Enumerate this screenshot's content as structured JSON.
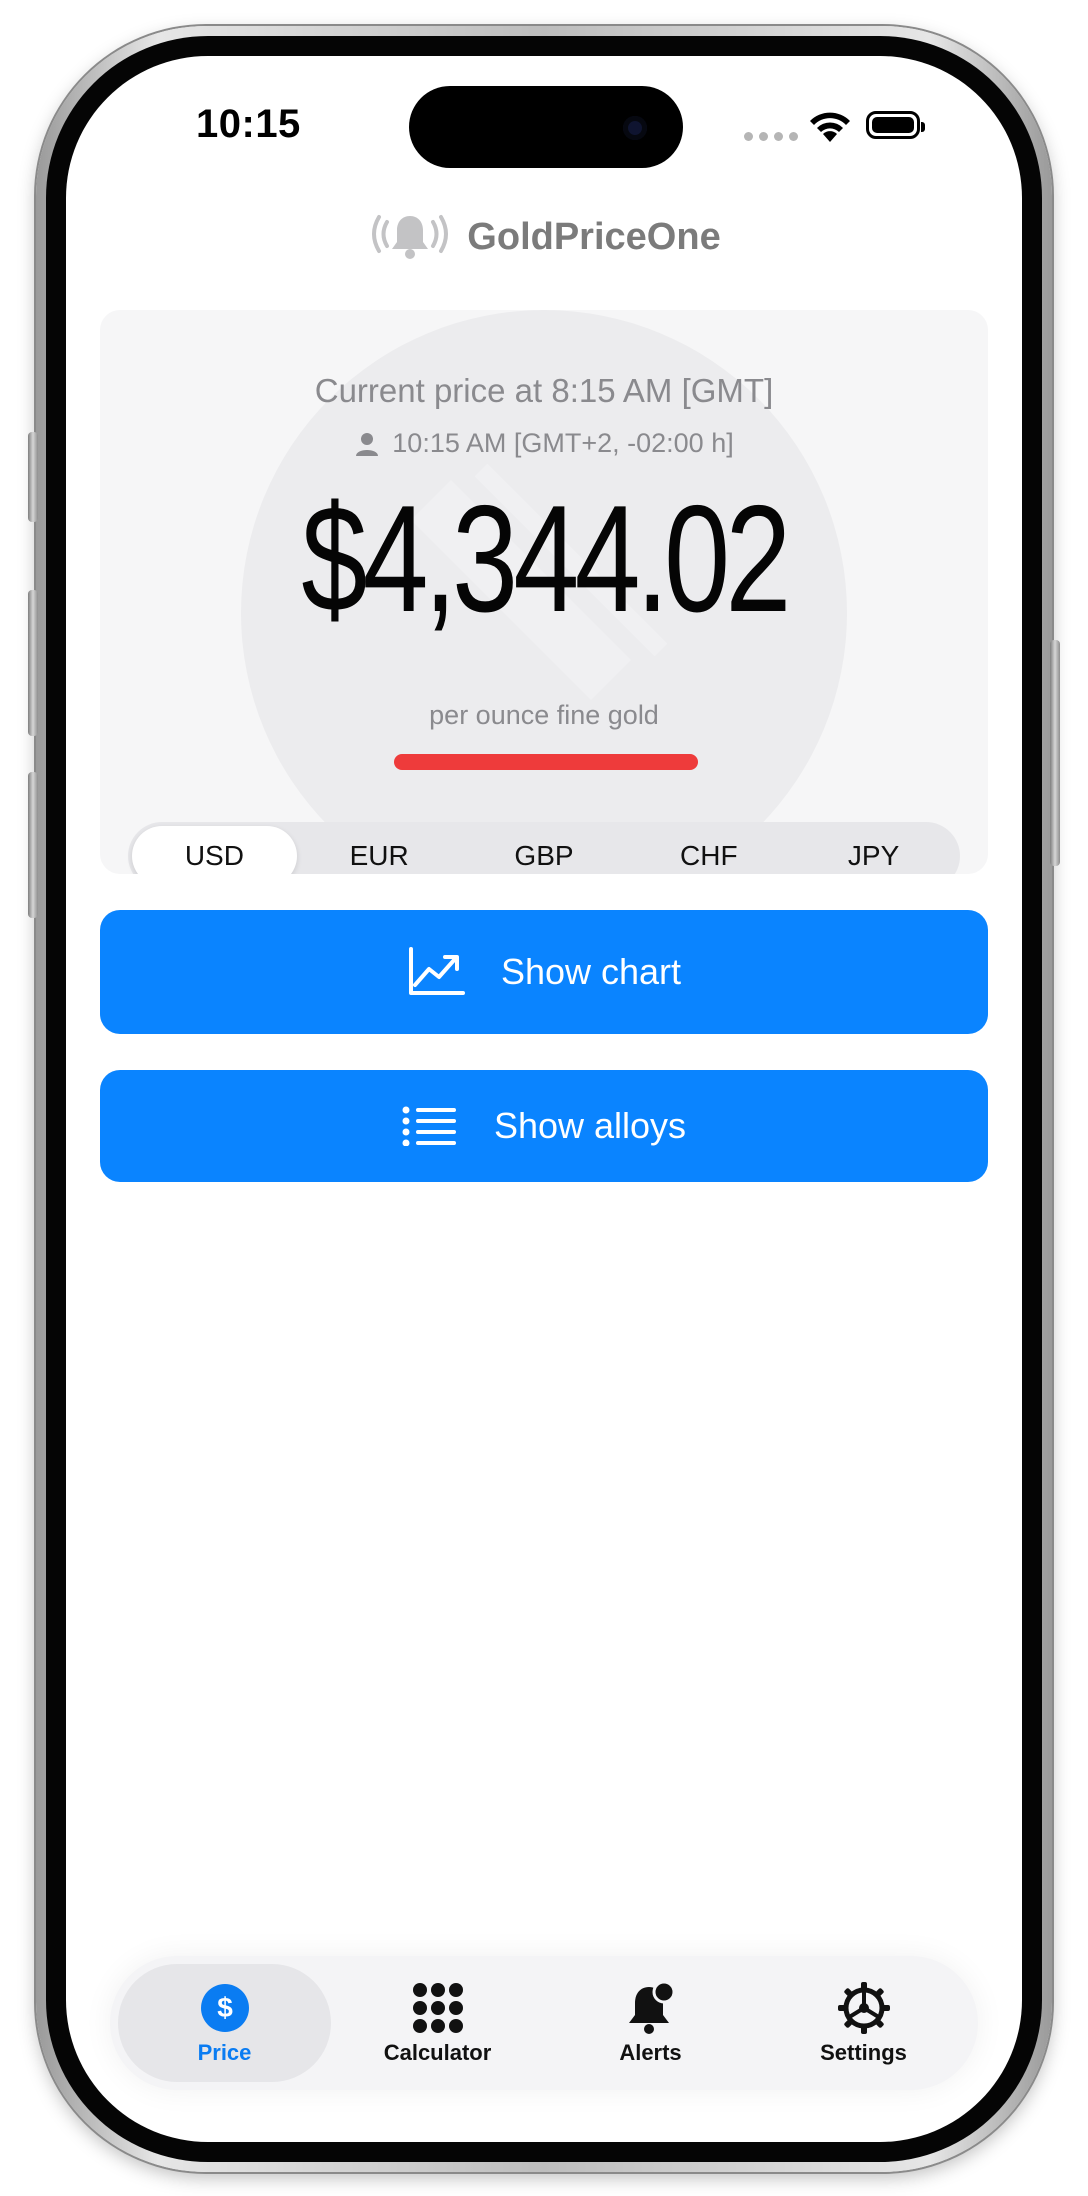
{
  "status_bar": {
    "time": "10:15"
  },
  "header": {
    "app_name": "GoldPriceOne",
    "icon": "bell-broadcast-icon"
  },
  "price_card": {
    "caption": "Current price at 8:15 AM [GMT]",
    "local_time": "10:15 AM [GMT+2, -02:00 h]",
    "price": "$4,344.02",
    "unit": "per ounce fine gold",
    "trend_color": "#ee3b3b"
  },
  "currencies": {
    "selected": "USD",
    "options": [
      "USD",
      "EUR",
      "GBP",
      "CHF",
      "JPY"
    ]
  },
  "actions": {
    "chart_label": "Show chart",
    "alloys_label": "Show alloys"
  },
  "tab_bar": {
    "active": "Price",
    "items": [
      {
        "label": "Price",
        "icon": "dollar-circle-icon"
      },
      {
        "label": "Calculator",
        "icon": "keypad-icon"
      },
      {
        "label": "Alerts",
        "icon": "bell-badge-icon"
      },
      {
        "label": "Settings",
        "icon": "gear-icon"
      }
    ]
  },
  "colors": {
    "accent": "#0a84ff",
    "tab_active": "#0a7cf2"
  }
}
